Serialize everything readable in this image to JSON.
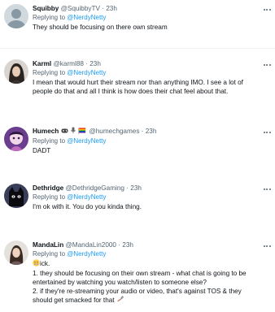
{
  "reply_prefix": "Replying to",
  "tweets": [
    {
      "name": "Squibby",
      "handle": "@SquibbyTV",
      "separator": "·",
      "time": "23h",
      "reply_to": "@NerdyNetty",
      "lines": [
        "They should be focusing on there own stream"
      ],
      "avatar_icon": "person-avatar-gray"
    },
    {
      "name": "Karml",
      "handle": "@karml88",
      "separator": "·",
      "time": "23h",
      "reply_to": "@NerdyNetty",
      "lines": [
        "I mean that would hurt their stream nor than anything IMO. I see a lot of",
        "people do that and all I think is how does their chat feel about that."
      ],
      "avatar_icon": "woman-photo-avatar"
    },
    {
      "name": "Humech",
      "handle": "@humechgames",
      "separator": "·",
      "time": "23h",
      "reply_to": "@NerdyNetty",
      "lines": [
        "DADT"
      ],
      "avatar_icon": "purple-character-avatar",
      "name_badges": [
        "gamepad-emoji",
        "microphone-emoji",
        "rainbow-flag-emoji"
      ]
    },
    {
      "name": "Dethridge",
      "handle": "@DethridgeGaming",
      "separator": "·",
      "time": "23h",
      "reply_to": "@NerdyNetty",
      "lines": [
        "I'm ok with it. You do you kinda thing."
      ],
      "avatar_icon": "black-cat-avatar"
    },
    {
      "name": "MandaLin",
      "handle": "@MandaLin2000",
      "separator": "·",
      "time": "23h",
      "reply_to": "@NerdyNetty",
      "lines": [
        "ick.",
        "1. they should be focusing on their own stream - what chat is going to be",
        "entertained by watching you watch/listen to someone else?",
        "2. if they're re-streaming your audio or video, that's against TOS & they",
        "should get smacked for that"
      ],
      "avatar_icon": "woman-photo-avatar-2",
      "leading_emoji": "grimace-emoji",
      "trailing_emoji": "hammer-emoji"
    }
  ],
  "colors": {
    "text": "#0f1419",
    "secondary": "#536471",
    "link": "#1d9bf0",
    "divider": "#eff3f4"
  }
}
